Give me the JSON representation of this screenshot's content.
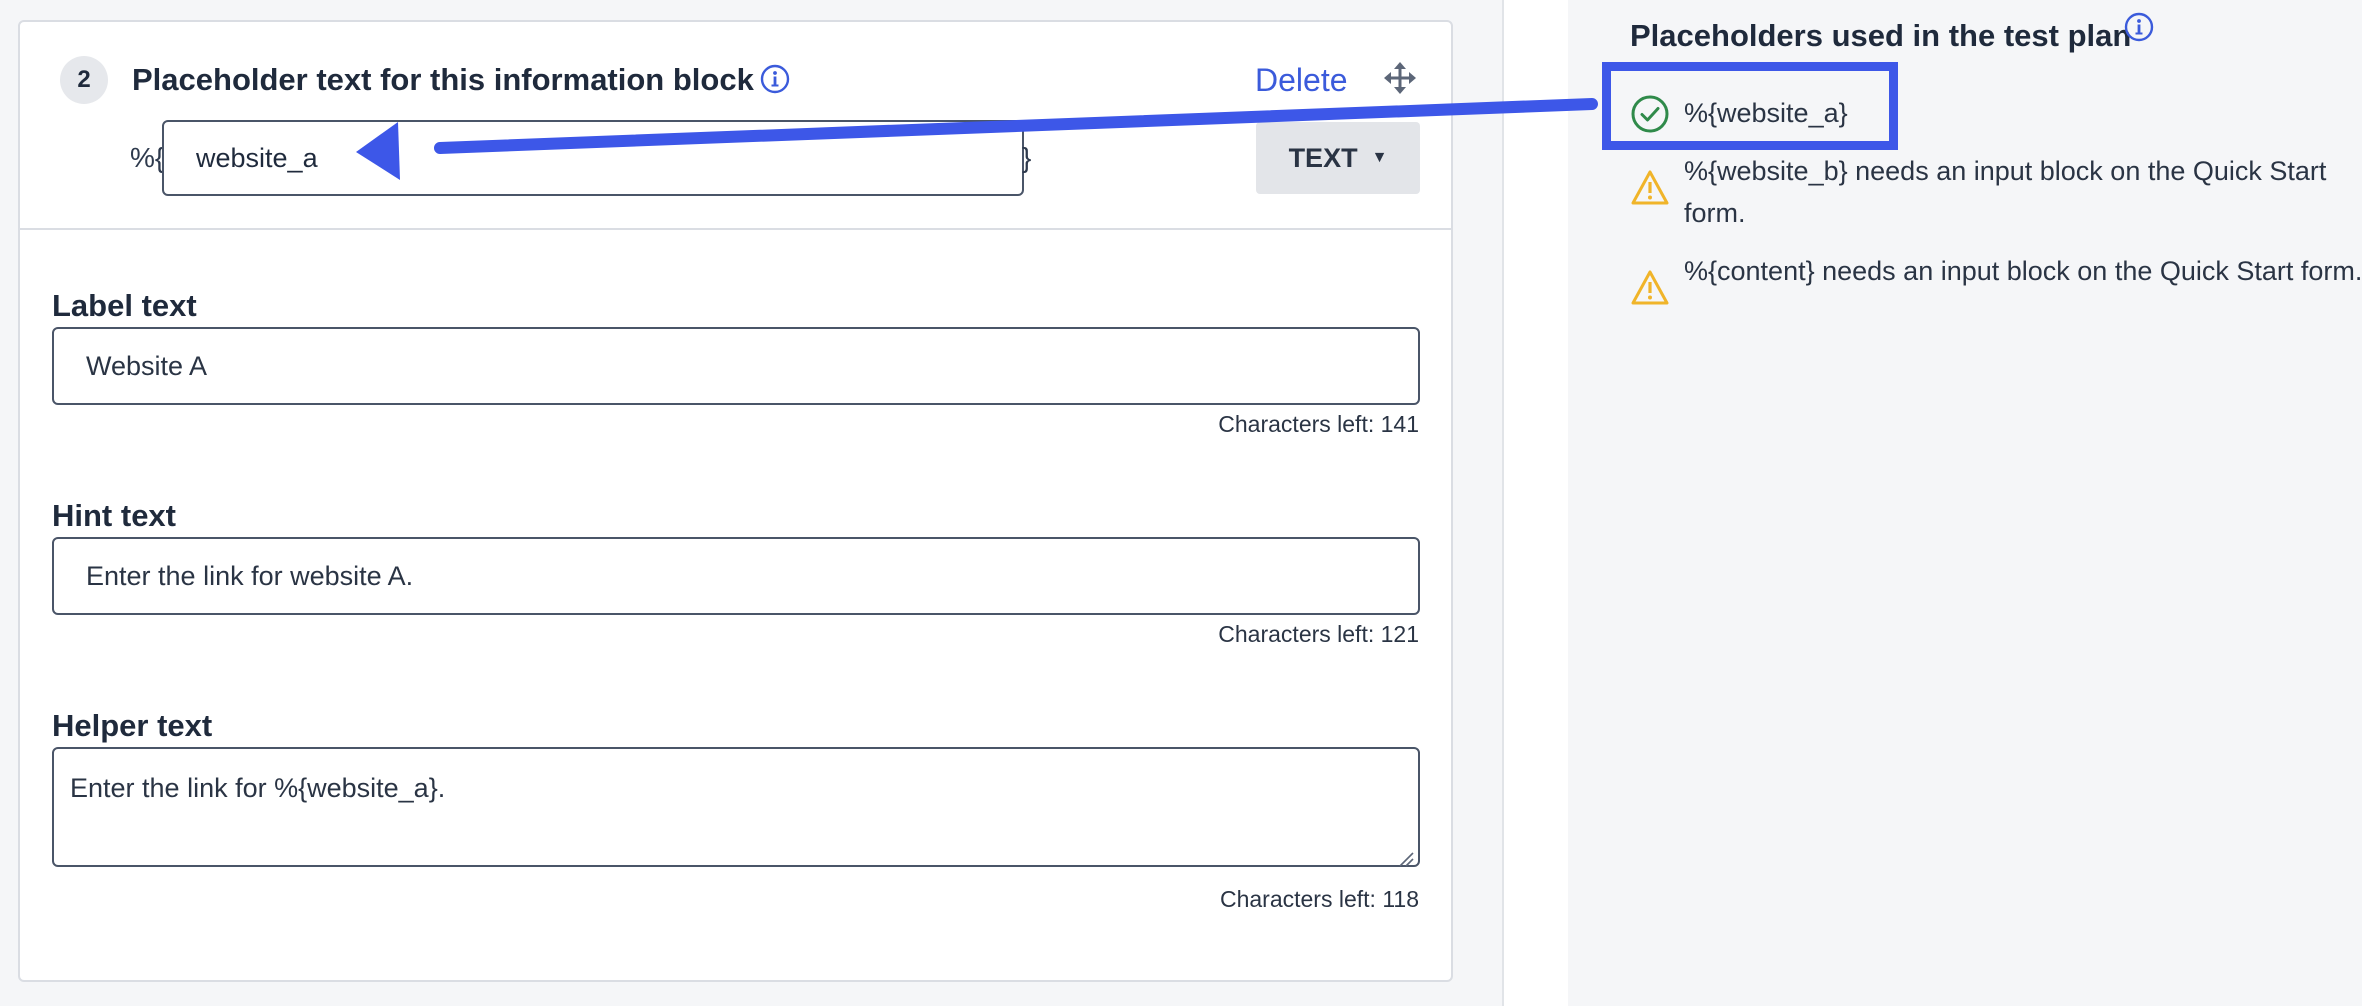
{
  "block": {
    "step_number": "2",
    "title": "Placeholder text for this information block",
    "delete_label": "Delete",
    "placeholder_prefix": "%{",
    "placeholder_value": "website_a",
    "placeholder_suffix": "}",
    "type_label": "TEXT"
  },
  "fields": {
    "label": {
      "heading": "Label text",
      "value": "Website A",
      "chars_left": "Characters left: 141"
    },
    "hint": {
      "heading": "Hint text",
      "value": "Enter the link for website A.",
      "chars_left": "Characters left: 121"
    },
    "helper": {
      "heading": "Helper text",
      "value": "Enter the link for %{website_a}.",
      "chars_left": "Characters left: 118"
    }
  },
  "placeholders_panel": {
    "title": "Placeholders used in the test plan",
    "items": [
      {
        "status": "ok",
        "text": "%{website_a}"
      },
      {
        "status": "warning",
        "text": "%{website_b} needs an input block on the Quick Start form."
      },
      {
        "status": "warning",
        "text": "%{content} needs an input block on the Quick Start form."
      }
    ]
  },
  "colors": {
    "accent_blue": "#3d57e8",
    "link_blue": "#3b5bdb",
    "ok_green": "#2f8a4a",
    "warning_yellow": "#f0b429"
  }
}
